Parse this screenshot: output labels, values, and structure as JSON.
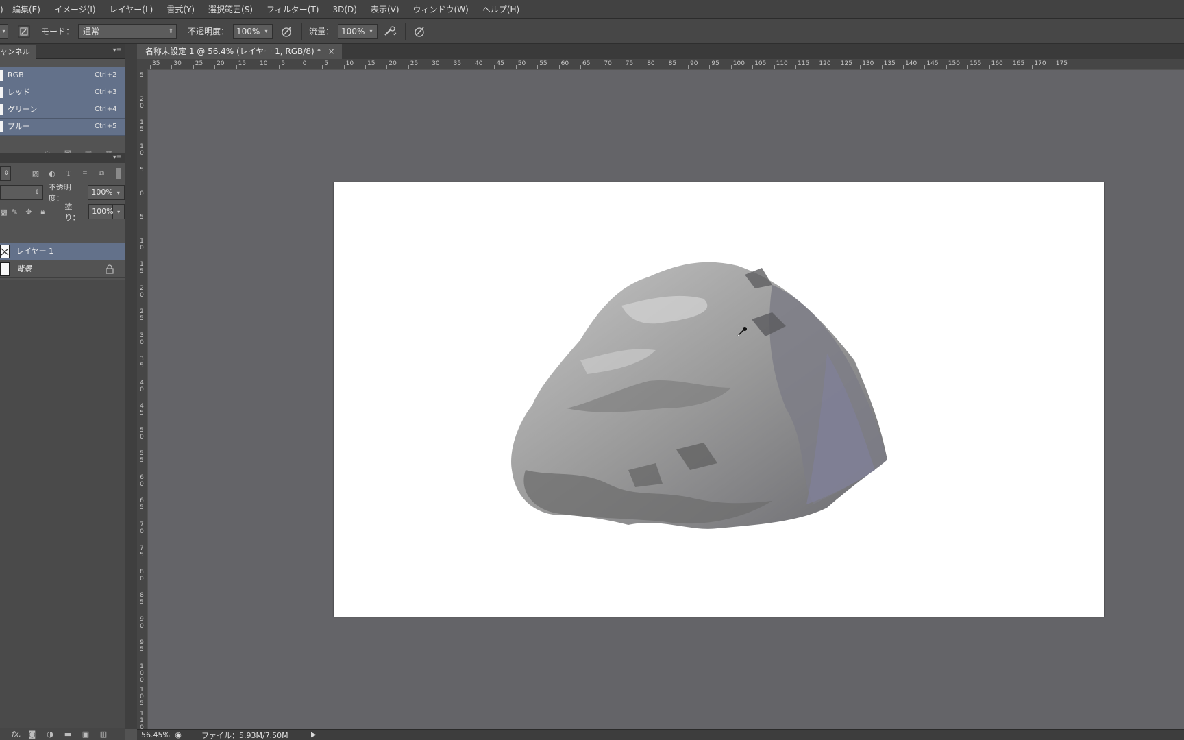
{
  "menubar": {
    "items": [
      "編集(E)",
      "イメージ(I)",
      "レイヤー(L)",
      "書式(Y)",
      "選択範囲(S)",
      "フィルター(T)",
      "3D(D)",
      "表示(V)",
      "ウィンドウ(W)",
      "ヘルプ(H)"
    ]
  },
  "options": {
    "mode_label": "モード：",
    "mode_value": "通常",
    "opacity_label": "不透明度：",
    "opacity_value": "100%",
    "flow_label": "流量：",
    "flow_value": "100%"
  },
  "channels": {
    "tab_label": "ャンネル",
    "rows": [
      {
        "name": "RGB",
        "shortcut": "Ctrl+2"
      },
      {
        "name": "レッド",
        "shortcut": "Ctrl+3"
      },
      {
        "name": "グリーン",
        "shortcut": "Ctrl+4"
      },
      {
        "name": "ブルー",
        "shortcut": "Ctrl+5"
      }
    ]
  },
  "layers": {
    "opacity_label": "不透明度：",
    "opacity_value": "100%",
    "fill_label": "塗り：",
    "fill_value": "100%",
    "rows": [
      {
        "name": "レイヤー 1",
        "selected": true,
        "italic": false,
        "locked": false
      },
      {
        "name": "背景",
        "selected": false,
        "italic": true,
        "locked": true
      }
    ]
  },
  "document": {
    "tab_title": "名称未設定 1 @ 56.4% (レイヤー 1, RGB/8) *",
    "close": "×"
  },
  "ruler": {
    "h_labels": [
      "35",
      "30",
      "25",
      "20",
      "15",
      "10",
      "5",
      "0",
      "5",
      "10",
      "15",
      "20",
      "25",
      "30",
      "35",
      "40",
      "45",
      "50",
      "55",
      "60",
      "65",
      "70",
      "75",
      "80",
      "85",
      "90",
      "95",
      "100",
      "105",
      "110",
      "115",
      "120",
      "125",
      "130",
      "135",
      "140",
      "145",
      "150",
      "155",
      "160",
      "165",
      "170",
      "175"
    ],
    "v_labels": [
      "5",
      "20",
      "15",
      "10",
      "5",
      "0",
      "5",
      "10",
      "15",
      "20",
      "25",
      "30",
      "35",
      "40",
      "45",
      "50",
      "55",
      "60",
      "65",
      "70",
      "75",
      "80",
      "85",
      "90",
      "95",
      "100",
      "105",
      "110"
    ]
  },
  "status": {
    "zoom": "56.45%",
    "file_label": "ファイル：5.93M/7.50M"
  },
  "icons": [
    "brush-preset-icon",
    "airbrush-icon",
    "pressure-icon",
    "dropdown-icon",
    "eyedropper-cursor-icon",
    "lock-icon",
    "link-icon",
    "fx-icon",
    "mask-icon",
    "adjustment-icon",
    "folder-icon",
    "new-layer-icon",
    "trash-icon"
  ]
}
